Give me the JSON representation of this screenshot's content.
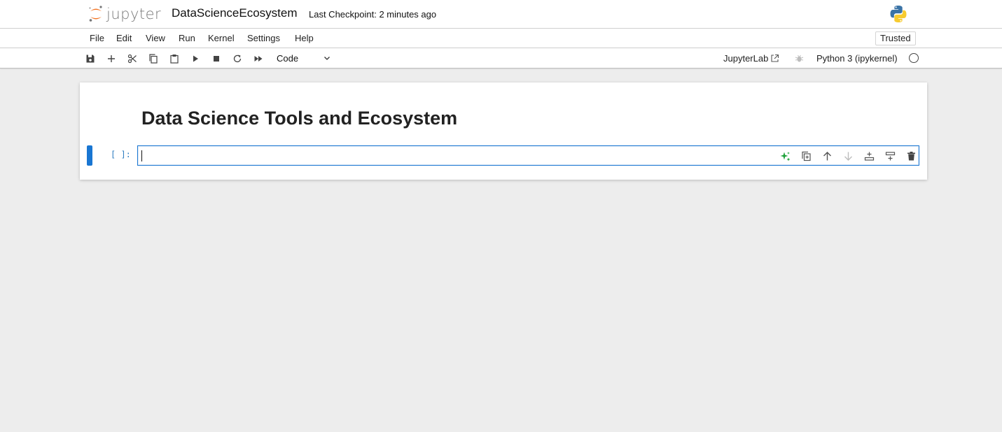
{
  "header": {
    "logo_text": "jupyter",
    "notebook_title": "DataScienceEcosystem",
    "checkpoint": "Last Checkpoint: 2 minutes ago"
  },
  "menu": {
    "items": [
      "File",
      "Edit",
      "View",
      "Run",
      "Kernel",
      "Settings",
      "Help"
    ],
    "trusted": "Trusted"
  },
  "toolbar": {
    "cell_type": "Code",
    "jupyterlab_link": "JupyterLab",
    "kernel": "Python 3 (ipykernel)",
    "icons": [
      "save-icon",
      "add-cell-icon",
      "cut-icon",
      "copy-icon",
      "paste-icon",
      "run-icon",
      "stop-icon",
      "restart-icon",
      "run-all-icon"
    ]
  },
  "notebook": {
    "markdown_heading": "Data Science Tools and Ecosystem",
    "code_cell": {
      "prompt": "[ ]:",
      "source": ""
    },
    "cell_toolbar_icons": [
      "ai-assist-icon",
      "duplicate-icon",
      "move-up-icon",
      "move-down-icon",
      "insert-below-icon",
      "insert-above-icon",
      "delete-icon"
    ]
  },
  "colors": {
    "accent": "#1976d2",
    "prompt": "#307fc1",
    "jupyter_orange": "#f37626",
    "ai_green": "#1ea23a"
  }
}
